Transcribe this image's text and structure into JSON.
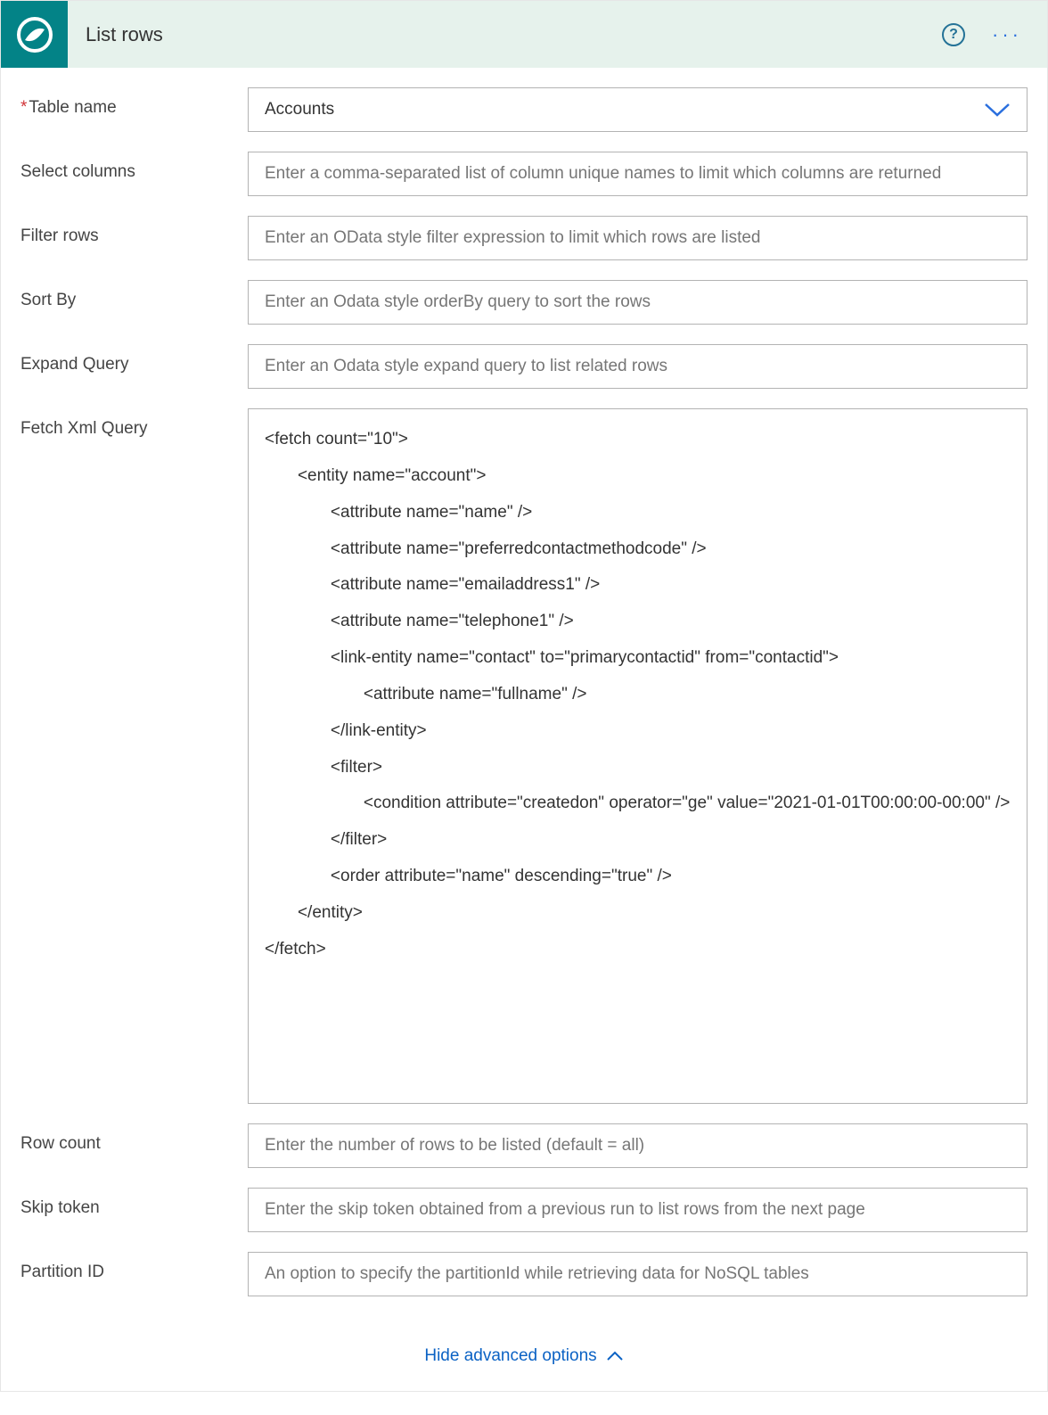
{
  "header": {
    "title": "List rows",
    "icon_name": "dataverse-swirl-icon"
  },
  "fields": {
    "table_name": {
      "label": "Table name",
      "value": "Accounts",
      "required": true
    },
    "select_columns": {
      "label": "Select columns",
      "placeholder": "Enter a comma-separated list of column unique names to limit which columns are returned"
    },
    "filter_rows": {
      "label": "Filter rows",
      "placeholder": "Enter an OData style filter expression to limit which rows are listed"
    },
    "sort_by": {
      "label": "Sort By",
      "placeholder": "Enter an Odata style orderBy query to sort the rows"
    },
    "expand_query": {
      "label": "Expand Query",
      "placeholder": "Enter an Odata style expand query to list related rows"
    },
    "fetch_xml": {
      "label": "Fetch Xml Query",
      "value": "<fetch count=\"10\">\n       <entity name=\"account\">\n              <attribute name=\"name\" />\n              <attribute name=\"preferredcontactmethodcode\" />\n              <attribute name=\"emailaddress1\" />\n              <attribute name=\"telephone1\" />\n              <link-entity name=\"contact\" to=\"primarycontactid\" from=\"contactid\">\n                     <attribute name=\"fullname\" />\n              </link-entity>\n              <filter>\n                     <condition attribute=\"createdon\" operator=\"ge\" value=\"2021-01-01T00:00:00-00:00\" />\n              </filter>\n              <order attribute=\"name\" descending=\"true\" />\n       </entity>\n</fetch>"
    },
    "row_count": {
      "label": "Row count",
      "placeholder": "Enter the number of rows to be listed (default = all)"
    },
    "skip_token": {
      "label": "Skip token",
      "placeholder": "Enter the skip token obtained from a previous run to list rows from the next page"
    },
    "partition_id": {
      "label": "Partition ID",
      "placeholder": "An option to specify the partitionId while retrieving data for NoSQL tables"
    }
  },
  "footer": {
    "toggle_label": "Hide advanced options"
  }
}
